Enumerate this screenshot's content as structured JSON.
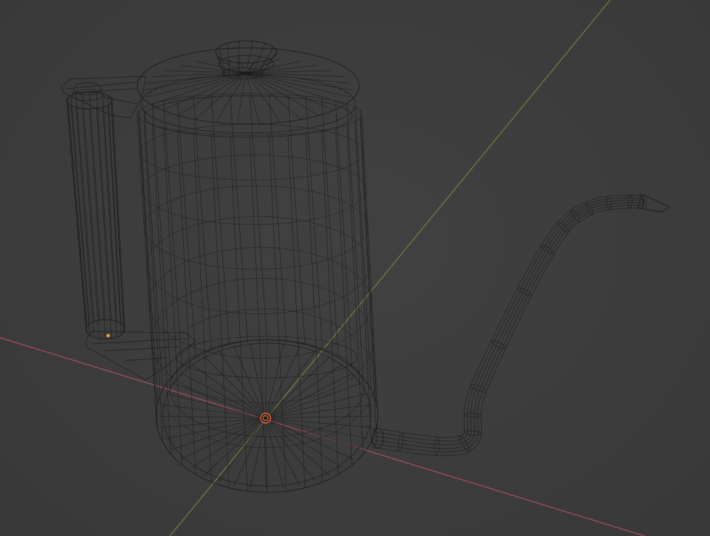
{
  "viewport": {
    "background": "#3d3d3d",
    "mode": "wireframe"
  },
  "colors": {
    "x_axis": "#b0505e",
    "y_axis": "#6f8a3a",
    "wire": "#1a1a1a",
    "origin": "#ff6a3a",
    "selected_vertex": "#ffa23a"
  },
  "objects": [
    {
      "name": "kettle-body",
      "icon": "wireframe-mesh"
    },
    {
      "name": "kettle-handle",
      "icon": "wireframe-mesh"
    },
    {
      "name": "kettle-spout",
      "icon": "wireframe-mesh"
    },
    {
      "name": "kettle-lid",
      "icon": "wireframe-mesh"
    }
  ]
}
